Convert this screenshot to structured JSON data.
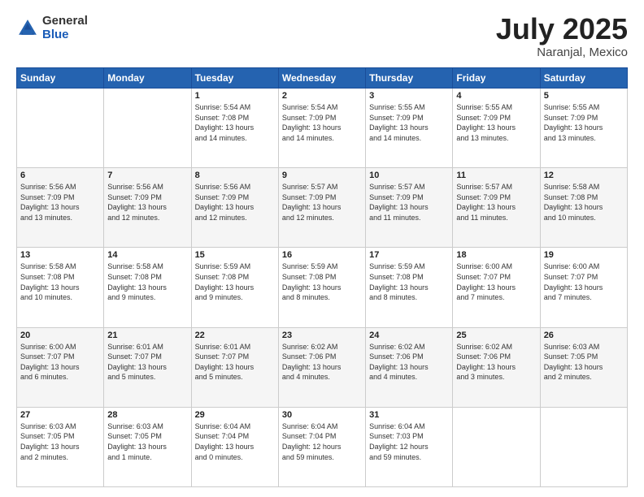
{
  "header": {
    "logo": {
      "general": "General",
      "blue": "Blue"
    },
    "title": "July 2025",
    "location": "Naranjal, Mexico"
  },
  "days_of_week": [
    "Sunday",
    "Monday",
    "Tuesday",
    "Wednesday",
    "Thursday",
    "Friday",
    "Saturday"
  ],
  "weeks": [
    [
      {
        "day": "",
        "info": ""
      },
      {
        "day": "",
        "info": ""
      },
      {
        "day": "1",
        "info": "Sunrise: 5:54 AM\nSunset: 7:08 PM\nDaylight: 13 hours\nand 14 minutes."
      },
      {
        "day": "2",
        "info": "Sunrise: 5:54 AM\nSunset: 7:09 PM\nDaylight: 13 hours\nand 14 minutes."
      },
      {
        "day": "3",
        "info": "Sunrise: 5:55 AM\nSunset: 7:09 PM\nDaylight: 13 hours\nand 14 minutes."
      },
      {
        "day": "4",
        "info": "Sunrise: 5:55 AM\nSunset: 7:09 PM\nDaylight: 13 hours\nand 13 minutes."
      },
      {
        "day": "5",
        "info": "Sunrise: 5:55 AM\nSunset: 7:09 PM\nDaylight: 13 hours\nand 13 minutes."
      }
    ],
    [
      {
        "day": "6",
        "info": "Sunrise: 5:56 AM\nSunset: 7:09 PM\nDaylight: 13 hours\nand 13 minutes."
      },
      {
        "day": "7",
        "info": "Sunrise: 5:56 AM\nSunset: 7:09 PM\nDaylight: 13 hours\nand 12 minutes."
      },
      {
        "day": "8",
        "info": "Sunrise: 5:56 AM\nSunset: 7:09 PM\nDaylight: 13 hours\nand 12 minutes."
      },
      {
        "day": "9",
        "info": "Sunrise: 5:57 AM\nSunset: 7:09 PM\nDaylight: 13 hours\nand 12 minutes."
      },
      {
        "day": "10",
        "info": "Sunrise: 5:57 AM\nSunset: 7:09 PM\nDaylight: 13 hours\nand 11 minutes."
      },
      {
        "day": "11",
        "info": "Sunrise: 5:57 AM\nSunset: 7:09 PM\nDaylight: 13 hours\nand 11 minutes."
      },
      {
        "day": "12",
        "info": "Sunrise: 5:58 AM\nSunset: 7:08 PM\nDaylight: 13 hours\nand 10 minutes."
      }
    ],
    [
      {
        "day": "13",
        "info": "Sunrise: 5:58 AM\nSunset: 7:08 PM\nDaylight: 13 hours\nand 10 minutes."
      },
      {
        "day": "14",
        "info": "Sunrise: 5:58 AM\nSunset: 7:08 PM\nDaylight: 13 hours\nand 9 minutes."
      },
      {
        "day": "15",
        "info": "Sunrise: 5:59 AM\nSunset: 7:08 PM\nDaylight: 13 hours\nand 9 minutes."
      },
      {
        "day": "16",
        "info": "Sunrise: 5:59 AM\nSunset: 7:08 PM\nDaylight: 13 hours\nand 8 minutes."
      },
      {
        "day": "17",
        "info": "Sunrise: 5:59 AM\nSunset: 7:08 PM\nDaylight: 13 hours\nand 8 minutes."
      },
      {
        "day": "18",
        "info": "Sunrise: 6:00 AM\nSunset: 7:07 PM\nDaylight: 13 hours\nand 7 minutes."
      },
      {
        "day": "19",
        "info": "Sunrise: 6:00 AM\nSunset: 7:07 PM\nDaylight: 13 hours\nand 7 minutes."
      }
    ],
    [
      {
        "day": "20",
        "info": "Sunrise: 6:00 AM\nSunset: 7:07 PM\nDaylight: 13 hours\nand 6 minutes."
      },
      {
        "day": "21",
        "info": "Sunrise: 6:01 AM\nSunset: 7:07 PM\nDaylight: 13 hours\nand 5 minutes."
      },
      {
        "day": "22",
        "info": "Sunrise: 6:01 AM\nSunset: 7:07 PM\nDaylight: 13 hours\nand 5 minutes."
      },
      {
        "day": "23",
        "info": "Sunrise: 6:02 AM\nSunset: 7:06 PM\nDaylight: 13 hours\nand 4 minutes."
      },
      {
        "day": "24",
        "info": "Sunrise: 6:02 AM\nSunset: 7:06 PM\nDaylight: 13 hours\nand 4 minutes."
      },
      {
        "day": "25",
        "info": "Sunrise: 6:02 AM\nSunset: 7:06 PM\nDaylight: 13 hours\nand 3 minutes."
      },
      {
        "day": "26",
        "info": "Sunrise: 6:03 AM\nSunset: 7:05 PM\nDaylight: 13 hours\nand 2 minutes."
      }
    ],
    [
      {
        "day": "27",
        "info": "Sunrise: 6:03 AM\nSunset: 7:05 PM\nDaylight: 13 hours\nand 2 minutes."
      },
      {
        "day": "28",
        "info": "Sunrise: 6:03 AM\nSunset: 7:05 PM\nDaylight: 13 hours\nand 1 minute."
      },
      {
        "day": "29",
        "info": "Sunrise: 6:04 AM\nSunset: 7:04 PM\nDaylight: 13 hours\nand 0 minutes."
      },
      {
        "day": "30",
        "info": "Sunrise: 6:04 AM\nSunset: 7:04 PM\nDaylight: 12 hours\nand 59 minutes."
      },
      {
        "day": "31",
        "info": "Sunrise: 6:04 AM\nSunset: 7:03 PM\nDaylight: 12 hours\nand 59 minutes."
      },
      {
        "day": "",
        "info": ""
      },
      {
        "day": "",
        "info": ""
      }
    ]
  ]
}
